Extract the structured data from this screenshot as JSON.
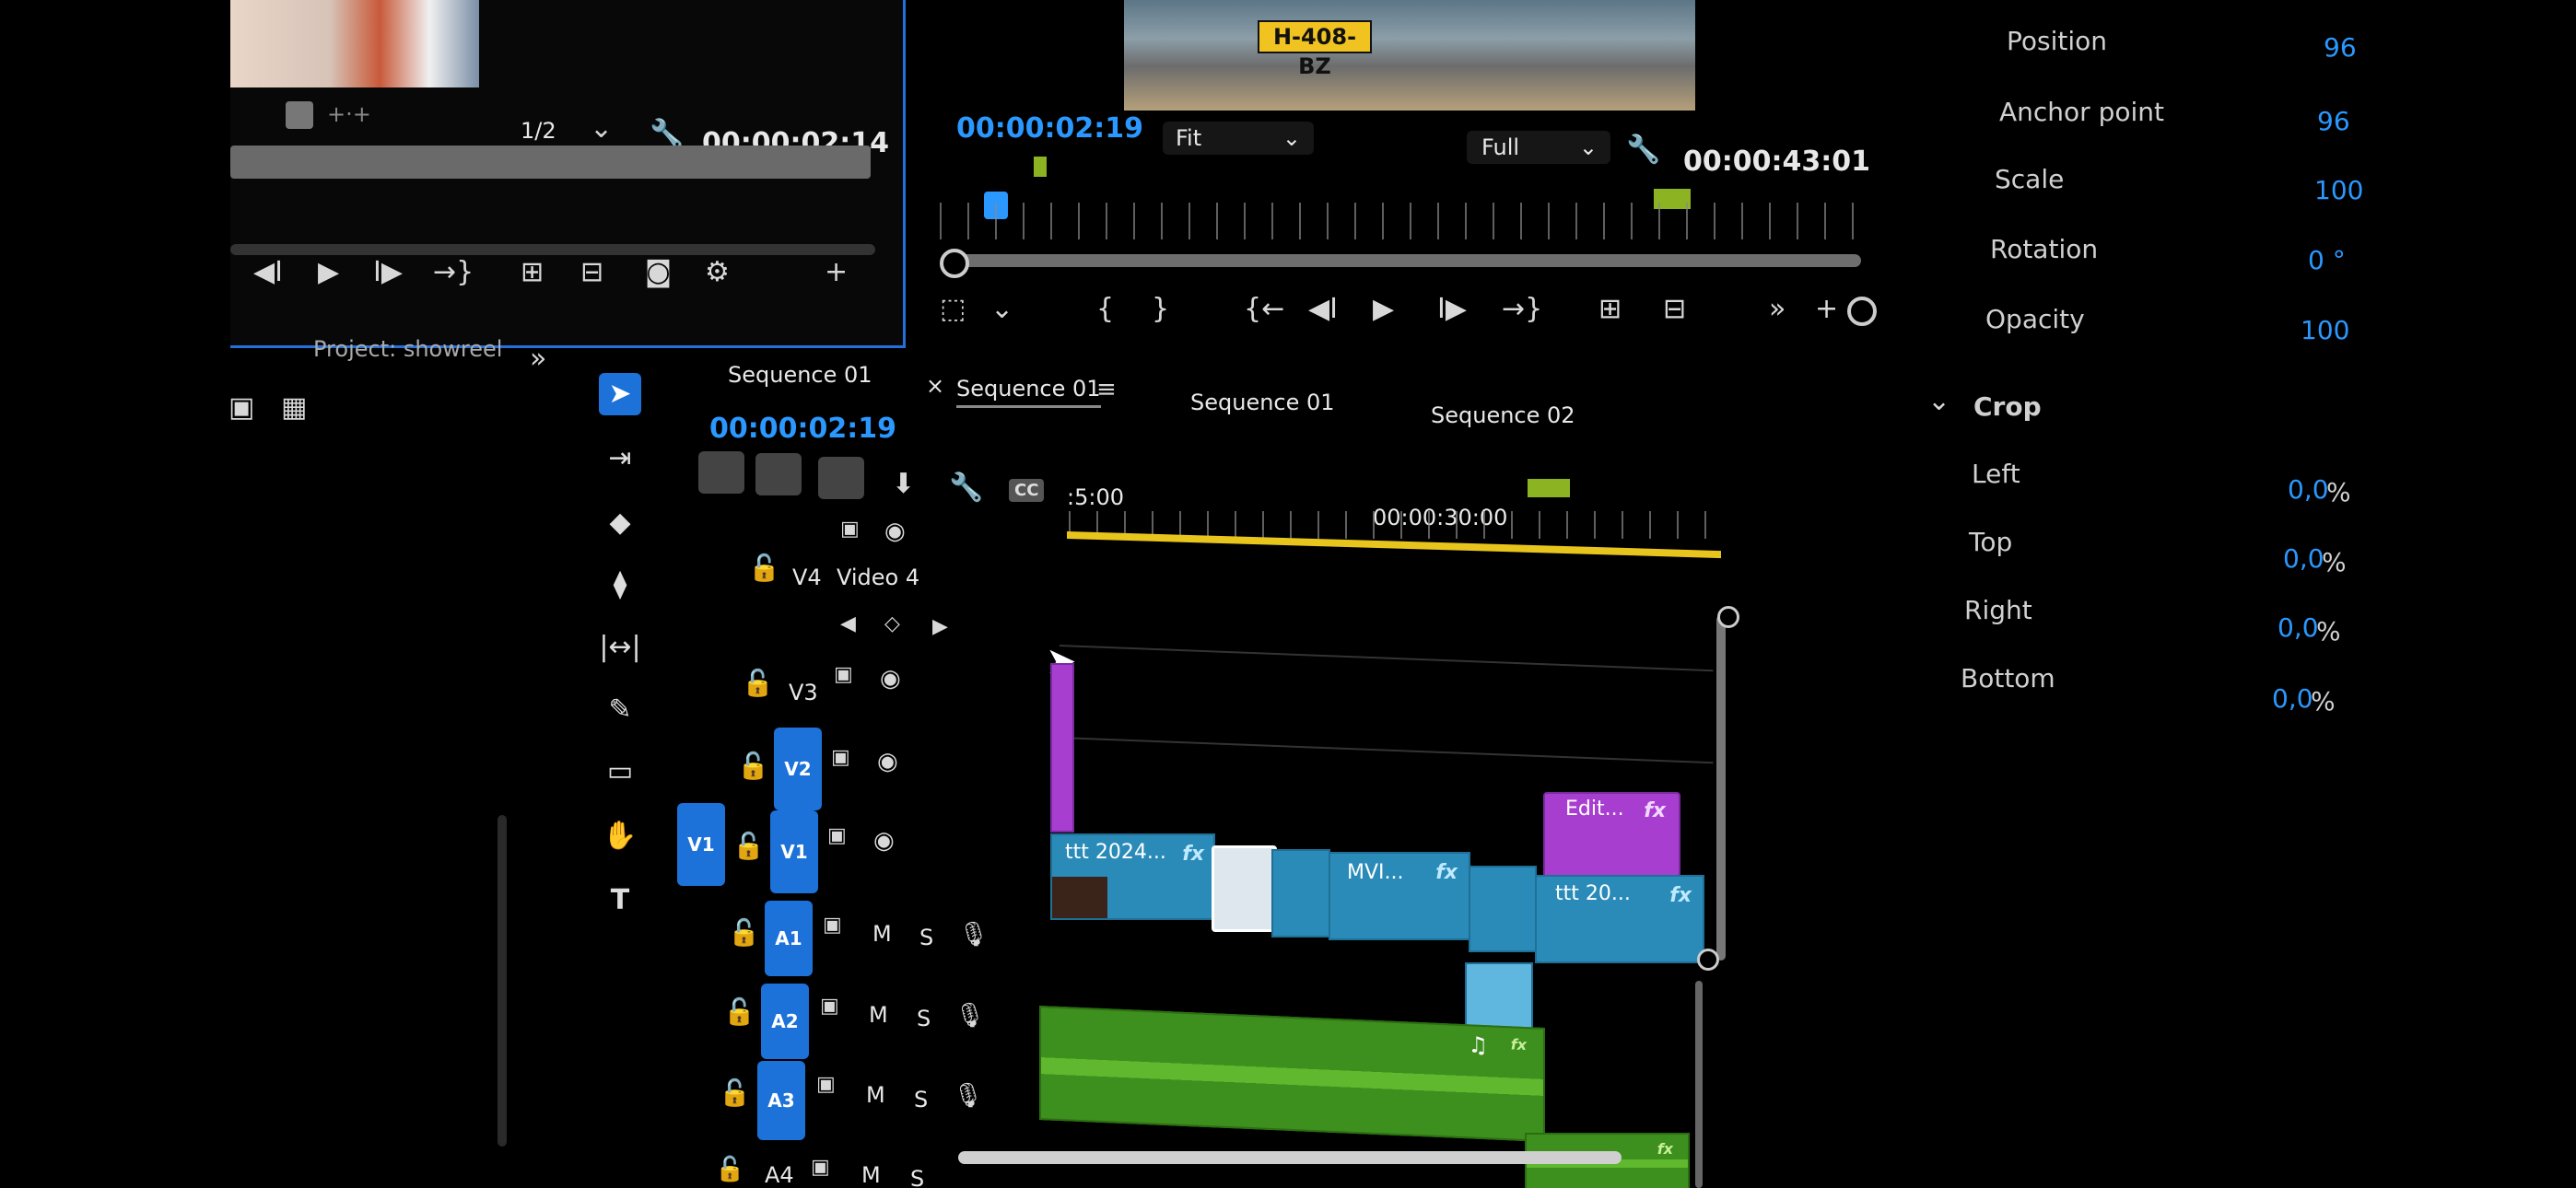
{
  "source_monitor": {
    "fraction": "1/2",
    "timecode": "00:00:02:14"
  },
  "program_monitor": {
    "plate_text": "H-408-BZ",
    "current_timecode": "00:00:02:19",
    "zoom": "Fit",
    "quality": "Full",
    "duration": "00:00:43:01"
  },
  "project_panel": {
    "title": "Project: showreel"
  },
  "timeline": {
    "title": "Sequence 01",
    "timecode": "00:00:02:19",
    "tabs": [
      {
        "label": "Sequence 01",
        "close": "×"
      },
      {
        "label": "Sequence 01"
      },
      {
        "label": "Sequence 02"
      }
    ],
    "ruler_start": ":5:00",
    "ruler_mark": "00:00:30:00",
    "tracks": {
      "v4": {
        "id": "V4",
        "name": "Video 4"
      },
      "v3": {
        "id": "V3"
      },
      "v2": {
        "id": "V2"
      },
      "v1": {
        "id": "V1",
        "source": "V1"
      },
      "a1": {
        "id": "A1",
        "m": "M",
        "s": "S"
      },
      "a2": {
        "id": "A2",
        "m": "M",
        "s": "S"
      },
      "a3": {
        "id": "A3",
        "m": "M",
        "s": "S"
      },
      "a4": {
        "id": "A4",
        "m": "M",
        "s": "S"
      }
    },
    "clips": {
      "v1_a": "ttt 2024...",
      "v1_b": "MVI...",
      "v1_c": "ttt 20...",
      "v2_edit": "Edit...",
      "fx": "fx",
      "cc": "CC"
    }
  },
  "effect_controls": {
    "properties": [
      {
        "label": "Position",
        "value": "96"
      },
      {
        "label": "Anchor point",
        "value": "96"
      },
      {
        "label": "Scale",
        "value": "100"
      },
      {
        "label": "Rotation",
        "value": "0 °"
      },
      {
        "label": "Opacity",
        "value": "100"
      }
    ],
    "crop_label": "Crop",
    "crop": [
      {
        "label": "Left",
        "value": "0,0",
        "unit": "%"
      },
      {
        "label": "Top",
        "value": "0,0",
        "unit": "%"
      },
      {
        "label": "Right",
        "value": "0,0",
        "unit": "%"
      },
      {
        "label": "Bottom",
        "value": "0,0",
        "unit": "%"
      }
    ]
  },
  "colors": {
    "accent_blue": "#2a98ff",
    "video_clip": "#2a8bb8",
    "audio_clip": "#3d8f1e",
    "adjust_clip": "#a83ed0",
    "playhead_bar": "#e8c51c"
  }
}
